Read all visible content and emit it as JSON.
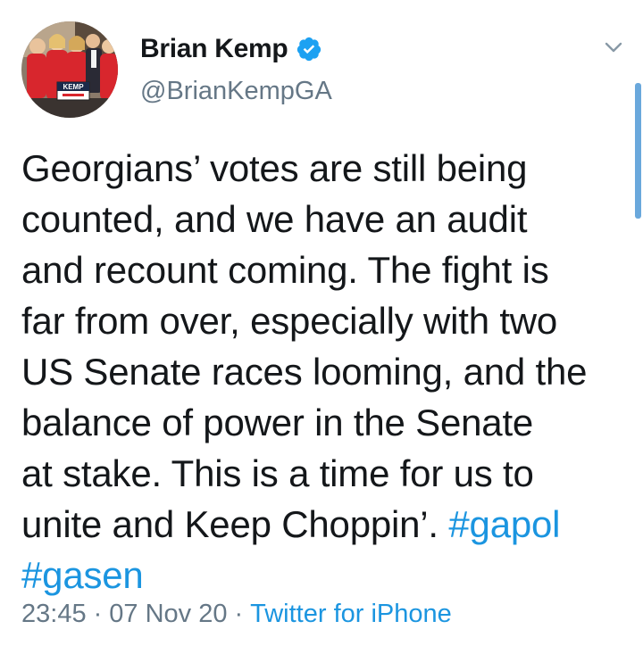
{
  "header": {
    "display_name": "Brian Kemp",
    "handle": "@BrianKempGA",
    "avatar_sign_text": "KEMP"
  },
  "tweet": {
    "text_lines": [
      "Georgians’ votes are still being",
      "counted, and we have an audit",
      "and recount coming. The fight is",
      "far from over, especially with two",
      "US Senate races looming, and the",
      "balance of power in the Senate",
      "at stake. This is a time for us to",
      "unite and Keep Choppin’. "
    ],
    "hashtags": [
      "#gapol",
      "#gasen"
    ]
  },
  "meta": {
    "time": "23:45",
    "date": "07 Nov 20",
    "separator": "·",
    "source": "Twitter for iPhone"
  },
  "colors": {
    "text": "#14171a",
    "secondary": "#657786",
    "link": "#1b95e0",
    "verified": "#1da1f2",
    "scrollbar": "#6aa8dc"
  },
  "icons": {
    "verified": "verified-badge-icon",
    "menu": "chevron-down-icon"
  }
}
